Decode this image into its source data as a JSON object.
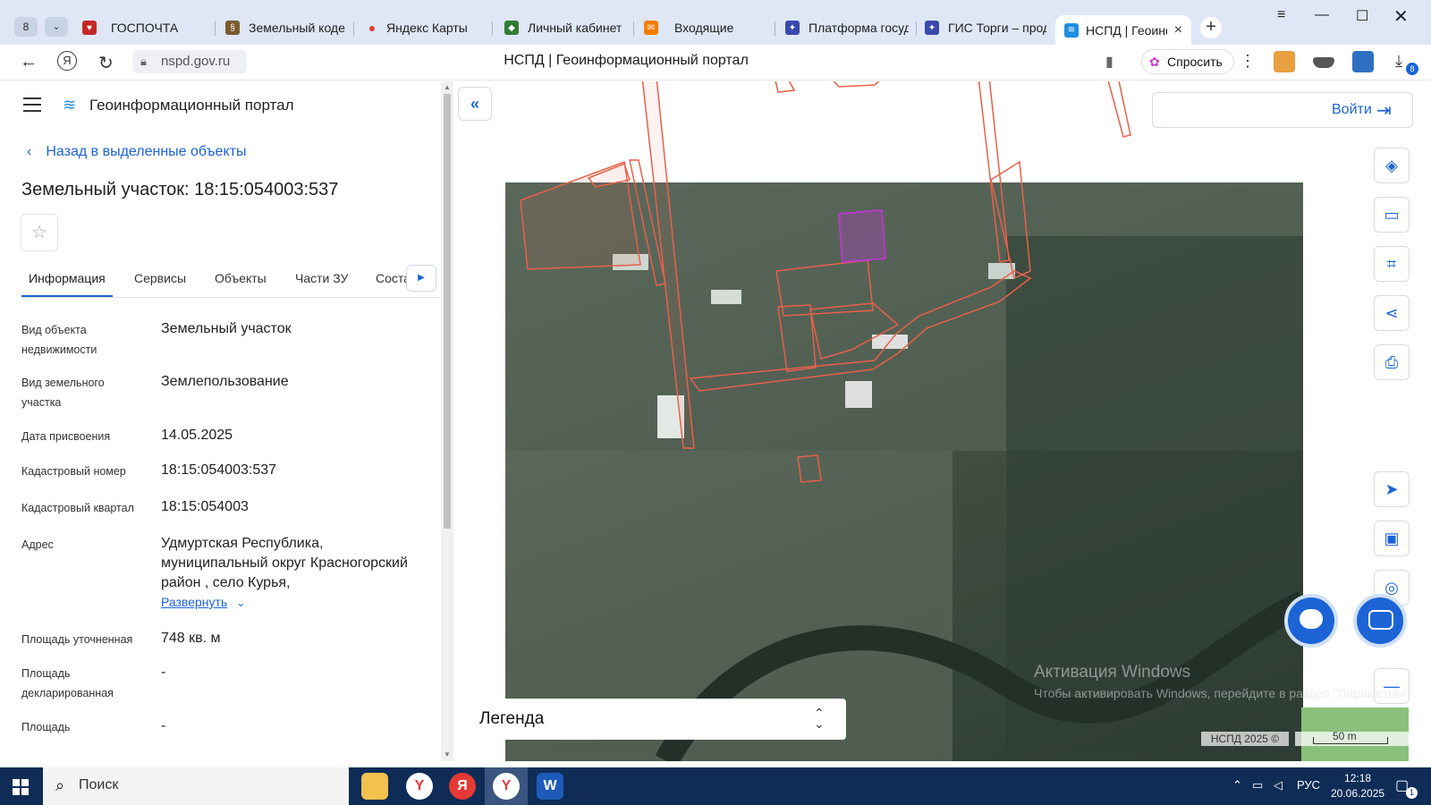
{
  "browser": {
    "tab_count": "8",
    "tabs": [
      {
        "label": "ГОСПОЧТА",
        "icon": "gospochta-icon",
        "color": "#c62828"
      },
      {
        "label": "Земельный кодекс",
        "icon": "law-icon",
        "color": "#7a5c2e"
      },
      {
        "label": "Яндекс Карты",
        "icon": "map-pin-icon",
        "color": "#e53935"
      },
      {
        "label": "Личный кабинет",
        "icon": "shield-icon",
        "color": "#2e7d32"
      },
      {
        "label": "Входящие",
        "icon": "mail-icon",
        "color": "#f57c00"
      },
      {
        "label": "Платформа госуда",
        "icon": "emblem-icon",
        "color": "#3949ab"
      },
      {
        "label": "ГИС Торги – прода",
        "icon": "emblem-icon",
        "color": "#3949ab"
      },
      {
        "label": "НСПД | Геоинфо",
        "icon": "nspd-icon",
        "color": "#1f8fe0"
      }
    ],
    "url": "nspd.gov.ru",
    "page_title": "НСПД | Геоинформационный портал",
    "ask_label": "Спросить",
    "download_badge": "8"
  },
  "panel": {
    "portal_name": "Геоинформационный портал",
    "back_label": "Назад в выделенные объекты",
    "object_title": "Земельный участок: 18:15:054003:537",
    "tabs": [
      "Информация",
      "Сервисы",
      "Объекты",
      "Части ЗУ",
      "Соста"
    ],
    "rows": [
      {
        "label": "Вид объекта недвижимости",
        "value": "Земельный участок"
      },
      {
        "label": "Вид земельного участка",
        "value": "Землепользование"
      },
      {
        "label": "Дата присвоения",
        "value": "14.05.2025"
      },
      {
        "label": "Кадастровый номер",
        "value": "18:15:054003:537"
      },
      {
        "label": "Кадастровый квартал",
        "value": "18:15:054003"
      },
      {
        "label": "Адрес",
        "value": "Удмуртская Республика, муниципальный округ Красногорский район , село Курья,"
      },
      {
        "label": "Площадь уточненная",
        "value": "748 кв. м"
      },
      {
        "label": "Площадь декларированная",
        "value": "-"
      },
      {
        "label": "Площадь",
        "value": "-"
      }
    ],
    "expand_label": "Развернуть"
  },
  "map": {
    "login_label": "Войти",
    "legend_label": "Легенда",
    "activation_title": "Активация Windows",
    "activation_text": "Чтобы активировать Windows, перейдите в раздел \"Параметры\".",
    "copyright": "НСПД 2025 ©",
    "scale": "50 m",
    "selected_color": "#b43cc8",
    "parcel_color": "#e8604a"
  },
  "taskbar": {
    "search_label": "Поиск",
    "lang": "РУС",
    "time": "12:18",
    "date": "20.06.2025",
    "notif_count": "1"
  }
}
